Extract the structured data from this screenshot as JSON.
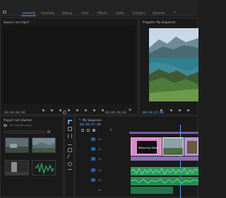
{
  "header": {
    "tabs": [
      {
        "label": "Learning"
      },
      {
        "label": "Assembly"
      },
      {
        "label": "Editing"
      },
      {
        "label": "Color"
      },
      {
        "label": "Effects"
      },
      {
        "label": "Audio"
      },
      {
        "label": "Graphics"
      },
      {
        "label": "Libraries"
      }
    ],
    "active_tab": "Learning"
  },
  "source_monitor": {
    "title": "Source: (no clips)",
    "timecode_left": "00;00;00;00",
    "timecode_right": "00;00;00;00"
  },
  "program_monitor": {
    "title": "Program: My Sequence",
    "timecode": "00;00;07;00"
  },
  "project_panel": {
    "title": "Project: Get Started",
    "search_placeholder": "Get Started.prproj"
  },
  "timeline": {
    "title": "My Sequence",
    "timecode": "00;00;07;00",
    "clips": [
      {
        "label": "Balancing Stone"
      }
    ],
    "track_labels": [
      "V3",
      "V2",
      "V1",
      "A1",
      "A2",
      "A3"
    ]
  },
  "colors": {
    "accent_blue": "#4d8ef0",
    "clip_pink": "#e08fd0",
    "clip_purple": "#b18fd6",
    "audio_green": "#2d9a5c"
  }
}
